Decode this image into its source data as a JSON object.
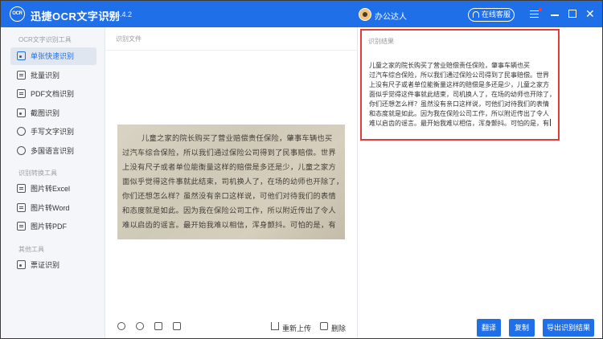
{
  "app": {
    "logo_text": "OCR",
    "title": "迅捷OCR文字识别",
    "version": "v8.6.4.2",
    "user": "办公达人",
    "service_label": "在线客服"
  },
  "sidebar": {
    "groups": [
      {
        "label": "OCR文字识别工具",
        "items": [
          {
            "label": "单张快速识别"
          },
          {
            "label": "批量识别"
          },
          {
            "label": "PDF文档识别"
          },
          {
            "label": "截图识别"
          },
          {
            "label": "手写文字识别"
          },
          {
            "label": "多国语言识别"
          }
        ]
      },
      {
        "label": "识别转换工具",
        "items": [
          {
            "label": "图片转Excel"
          },
          {
            "label": "图片转Word"
          },
          {
            "label": "图片转PDF"
          }
        ]
      },
      {
        "label": "其他工具",
        "items": [
          {
            "label": "票证识别"
          }
        ]
      }
    ]
  },
  "left_panel": {
    "header": "识别文件",
    "photo_lines": [
      "儿童之家的院长购买了营业赔偿责任保险，肇事车辆也买",
      "过汽车综合保险，所以我们通过保险公司得到了民事赔偿。世界",
      "上没有尺子或者单位能衡量这样的赔偿是多还是少，儿童之家方",
      "面似乎觉得这件事就此结束，司机换人了，在场的幼师也开除了，",
      "你们还想怎么样？虽然没有亲口这样说，可他们对待我们的表情",
      "和态度就是如此。因为我在保险公司工作，所以附近传出了令人",
      "难以启齿的谣言。最开始我难以相信，浑身颤抖。可怕的是，有"
    ],
    "toolbar": {
      "reupload": "重新上传",
      "delete": "删除"
    }
  },
  "right_panel": {
    "header": "识别结果",
    "result_lines": [
      "儿童之家的院长购买了营业赔偿责任保险，肇事车辆也买",
      "过汽车综合保险，所以我们通过保险公司得到了民事赔偿。世界",
      "上没有尺子或者单位能衡量这样的赔偿是多还是少，儿童之家方",
      "面似乎觉得这件事就此结束，司机换人了，在场的幼师也开除了，",
      "你们还想怎么样？虽然没有亲口这样说，可他们对待我们的表情",
      "和态度就是如此。因为我在保险公司工作，所以附近传出了令人",
      "难以启齿的谣言。最开始我难以相信，浑身颤抖。可怕的是，有"
    ],
    "buttons": {
      "translate": "翻译",
      "copy": "复制",
      "export": "导出识别结果"
    }
  },
  "colors": {
    "accent": "#1e6fe8",
    "highlight_border": "#e43a3a"
  }
}
